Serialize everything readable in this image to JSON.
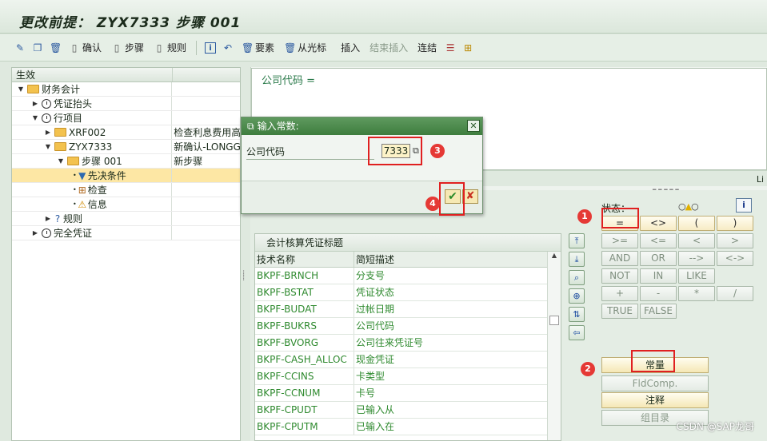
{
  "title": "更改前提： ZYX7333 步骤 001",
  "toolbar": {
    "confirm": "确认",
    "step": "步骤",
    "rule": "规则",
    "element": "要素",
    "from_cursor": "从光标",
    "insert": "插入",
    "end_insert": "结束插入",
    "connect": "连结"
  },
  "tree": {
    "header": "生效",
    "rows": [
      {
        "label": "财务会计",
        "desc": ""
      },
      {
        "label": "凭证抬头",
        "desc": ""
      },
      {
        "label": "行项目",
        "desc": ""
      },
      {
        "label": "XRF002",
        "desc": "检查利息费用高"
      },
      {
        "label": "ZYX7333",
        "desc": "新确认-LONGGE"
      },
      {
        "label": "步骤 001",
        "desc": "新步骤"
      },
      {
        "label": "先决条件",
        "desc": ""
      },
      {
        "label": "检查",
        "desc": ""
      },
      {
        "label": "信息",
        "desc": ""
      },
      {
        "label": "规则",
        "desc": ""
      },
      {
        "label": "完全凭证",
        "desc": ""
      }
    ]
  },
  "expression": {
    "text": "公司代码 ="
  },
  "splitter_label": "Li",
  "table": {
    "caption": "会计核算凭证标题",
    "col_name": "技术名称",
    "col_desc": "简短描述",
    "rows": [
      [
        "BKPF-BRNCH",
        "分支号"
      ],
      [
        "BKPF-BSTAT",
        "凭证状态"
      ],
      [
        "BKPF-BUDAT",
        "过帐日期"
      ],
      [
        "BKPF-BUKRS",
        "公司代码"
      ],
      [
        "BKPF-BVORG",
        "公司往来凭证号"
      ],
      [
        "BKPF-CASH_ALLOC",
        "现金凭证"
      ],
      [
        "BKPF-CCINS",
        "卡类型"
      ],
      [
        "BKPF-CCNUM",
        "卡号"
      ],
      [
        "BKPF-CPUDT",
        "已输入从"
      ],
      [
        "BKPF-CPUTM",
        "已输入在"
      ]
    ]
  },
  "status_label": "状态：",
  "ops": [
    "=",
    "<>",
    "(",
    ")",
    ">=",
    "<=",
    "<",
    ">",
    "AND",
    "OR",
    "-->",
    "<->",
    "NOT",
    "IN",
    "LIKE",
    "",
    "+",
    "-",
    "*",
    "/",
    "TRUE",
    "FALSE",
    "",
    ""
  ],
  "buttons": {
    "constant": "常量",
    "fldcomp": "FldComp.",
    "note": "注释",
    "group": "组目录"
  },
  "dialog": {
    "title": "输入常数:",
    "field_label": "公司代码",
    "field_value": "7333"
  },
  "badges": [
    "1",
    "2",
    "3",
    "4"
  ],
  "watermark": "CSDN @SAP龙哥"
}
